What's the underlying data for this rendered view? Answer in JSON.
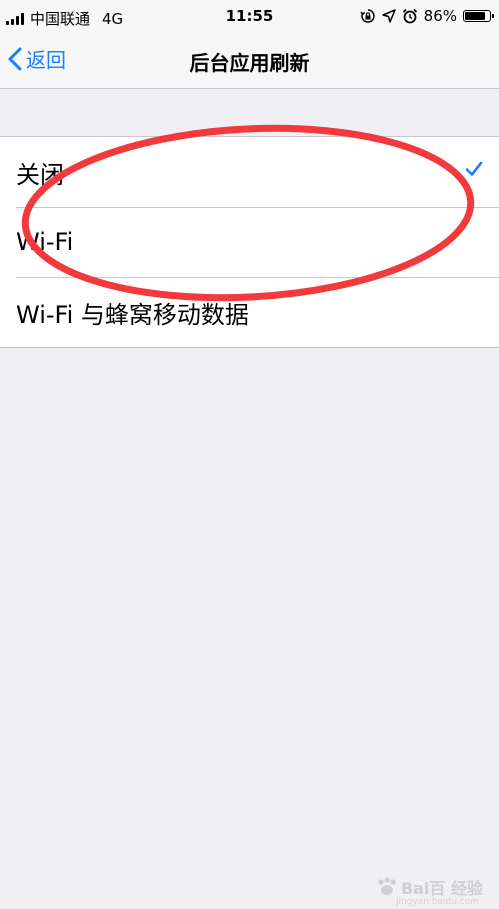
{
  "status_bar": {
    "carrier": "中国联通",
    "network": "4G",
    "time": "11:55",
    "battery_percent": "86%",
    "battery_level": 0.86,
    "icons": [
      "signal-icon",
      "orientation-lock-icon",
      "location-icon",
      "alarm-icon",
      "battery-icon"
    ]
  },
  "nav": {
    "back_label": "返回",
    "title": "后台应用刷新"
  },
  "options": [
    {
      "label": "关闭",
      "selected": true
    },
    {
      "label": "Wi-Fi",
      "selected": false
    },
    {
      "label": "Wi-Fi 与蜂窝移动数据",
      "selected": false
    }
  ],
  "watermark": {
    "text": "Bai百 经验",
    "subtext": "jingyan.baidu.com"
  },
  "colors": {
    "accent": "#1a7ef7",
    "annotation": "#f03a3c",
    "background": "#efeff4"
  }
}
